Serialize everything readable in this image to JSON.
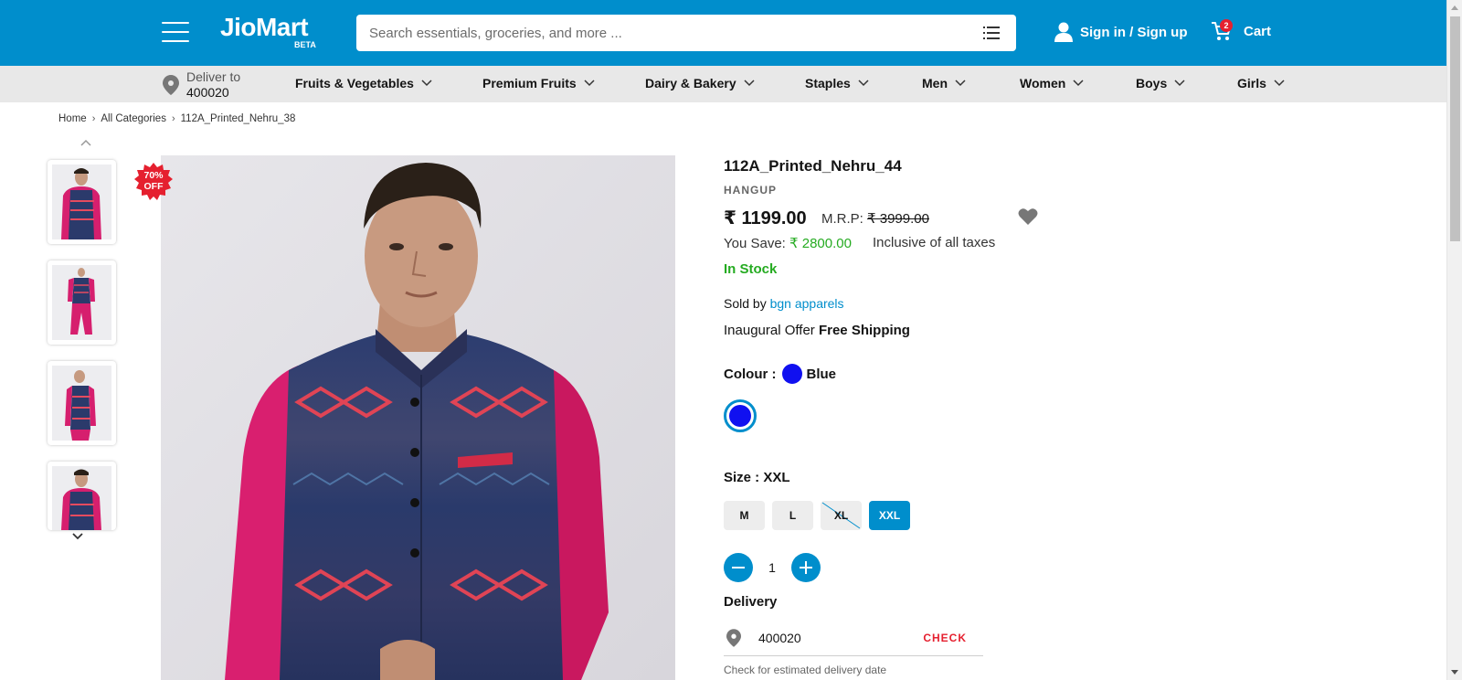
{
  "header": {
    "logo": "JioMart",
    "logo_badge": "BETA",
    "search_placeholder": "Search essentials, groceries, and more ...",
    "sign_in": "Sign in / Sign up",
    "cart_label": "Cart",
    "cart_count": "2",
    "brand_color": "#008ecc"
  },
  "nav": {
    "deliver_label": "Deliver to",
    "deliver_pincode": "400020",
    "categories": [
      "Fruits & Vegetables",
      "Premium Fruits",
      "Dairy & Bakery",
      "Staples",
      "Men",
      "Women",
      "Boys",
      "Girls"
    ]
  },
  "breadcrumb": [
    "Home",
    "All Categories",
    "112A_Printed_Nehru_38"
  ],
  "offer_badge": {
    "line1": "70%",
    "line2": "OFF"
  },
  "product": {
    "title": "112A_Printed_Nehru_44",
    "brand": "HANGUP",
    "price": "₹ 1199.00",
    "mrp_label": "M.R.P:",
    "mrp_value": "₹ 3999.00",
    "save_label": "You Save:",
    "save_value": "₹ 2800.00",
    "tax_note": "Inclusive of all taxes",
    "stock": "In Stock",
    "sold_by_label": "Sold by",
    "seller": "bgn apparels",
    "offer_label": "Inaugural Offer",
    "offer_value": "Free Shipping",
    "colour_label": "Colour :",
    "colour_value": "Blue",
    "colour_hex": "#1010f0",
    "size_label": "Size : XXL",
    "sizes": [
      {
        "label": "M",
        "state": "available"
      },
      {
        "label": "L",
        "state": "available"
      },
      {
        "label": "XL",
        "state": "unavailable"
      },
      {
        "label": "XXL",
        "state": "selected"
      }
    ],
    "quantity": "1",
    "delivery_label": "Delivery",
    "delivery_pincode": "400020",
    "check_label": "CHECK",
    "delivery_note": "Check for estimated delivery date"
  }
}
